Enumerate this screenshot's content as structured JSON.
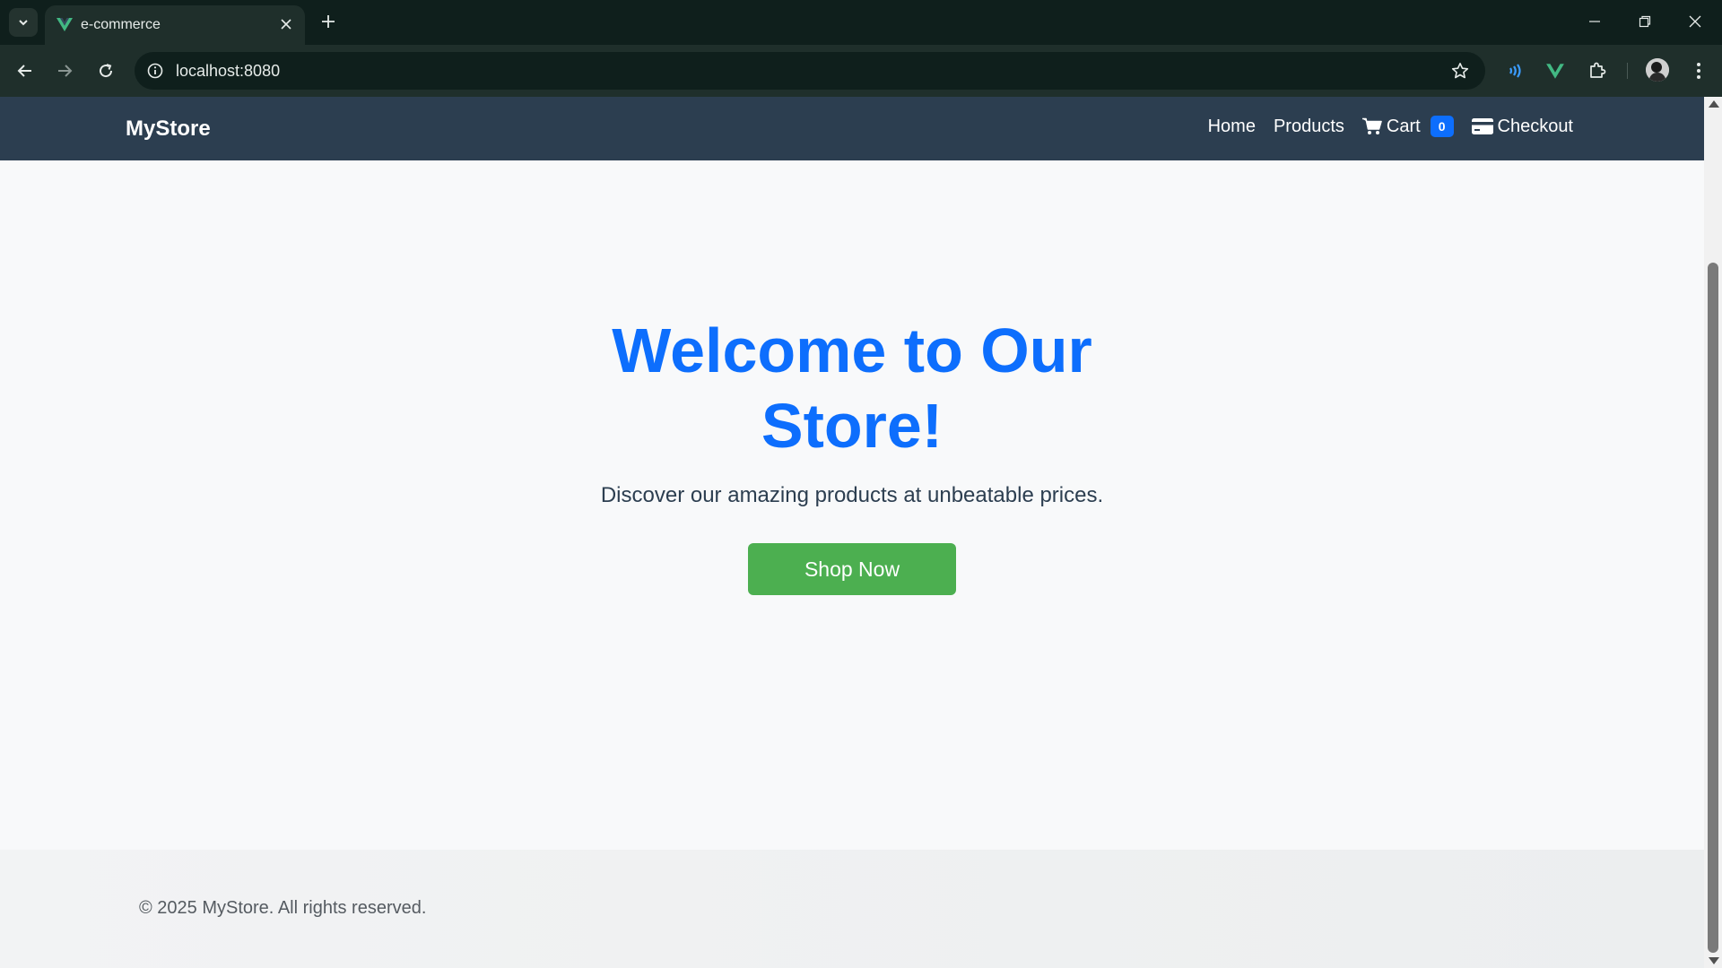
{
  "browser": {
    "tab_title": "e-commerce",
    "url": "localhost:8080",
    "icons": {
      "tab_search": "chevron-down-icon",
      "favicon": "vue-logo-icon",
      "close": "close-icon",
      "new_tab": "plus-icon",
      "back": "arrow-left-icon",
      "forward": "arrow-right-icon",
      "reload": "reload-icon",
      "site_info": "info-icon",
      "bookmark": "star-icon",
      "extensions": "puzzle-icon",
      "menu": "kebab-menu-icon"
    },
    "colors": {
      "frame": "#0f1f1c",
      "toolbar": "#1f2f2b",
      "vue_green": "#42b883"
    }
  },
  "site": {
    "brand": "MyStore",
    "nav": {
      "home": "Home",
      "products": "Products",
      "cart": "Cart",
      "cart_count": "0",
      "checkout": "Checkout"
    },
    "hero": {
      "title": "Welcome to Our Store!",
      "subtitle": "Discover our amazing products at unbeatable prices.",
      "cta": "Shop Now"
    },
    "footer": {
      "text": "© 2025 MyStore. All rights reserved."
    },
    "colors": {
      "navbar": "#2c3e50",
      "title": "#0d6efd",
      "cta": "#4caf50",
      "badge": "#0d6efd",
      "background": "#f8f9fa"
    }
  }
}
